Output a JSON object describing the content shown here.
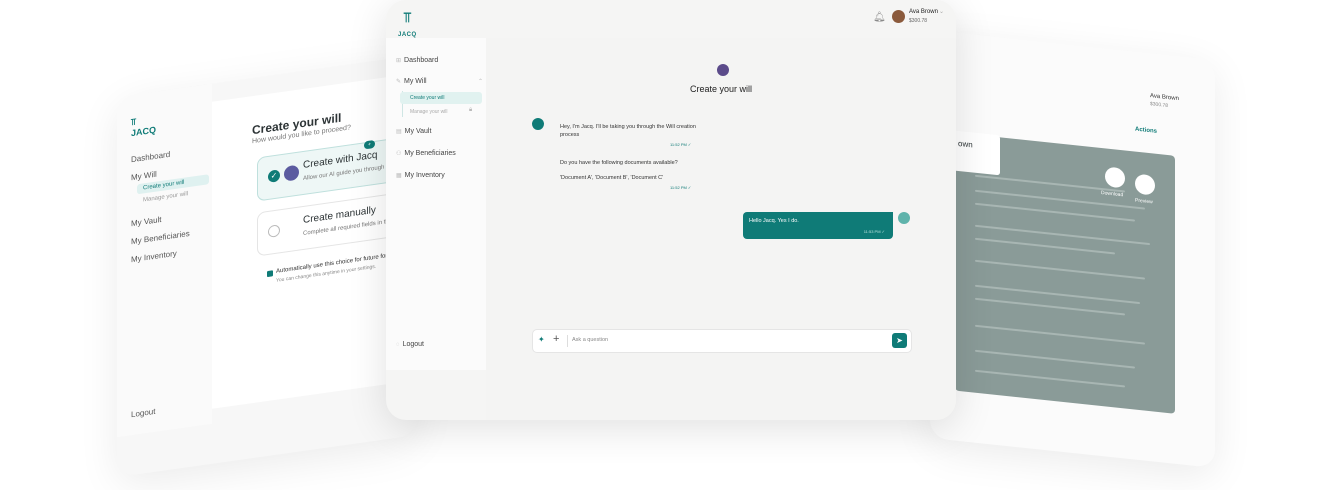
{
  "brand": {
    "name": "JACQ"
  },
  "user": {
    "name": "Ava Brown",
    "balance": "$300.78"
  },
  "nav": {
    "dashboard": "Dashboard",
    "my_will": "My Will",
    "create_will": "Create your will",
    "manage_will": "Manage your will",
    "my_vault": "My Vault",
    "my_beneficiaries": "My Beneficiaries",
    "my_inventory": "My Inventory",
    "logout": "Logout"
  },
  "left_card": {
    "title": "Create your will",
    "subtitle": "How would you like to proceed?",
    "option_jacq_title": "Create with Jacq",
    "option_jacq_desc": "Allow our AI guide you through the will",
    "option_manual_title": "Create manually",
    "option_manual_desc": "Complete all required fields in the w",
    "auto_save": "Automatically use this choice for future forms",
    "auto_save_note": "You can change this anytime in your settings."
  },
  "chat": {
    "title": "Create your will",
    "messages": [
      {
        "text": "Hey, I'm Jacq. I'll be taking you through the Will creation process",
        "time": "11:52 PM ✓"
      },
      {
        "text": "Do you have the following documents available?",
        "time": ""
      },
      {
        "text": "'Document A', 'Document B', 'Document C'",
        "time": "11:52 PM ✓"
      }
    ],
    "user_reply": {
      "text": "Hello Jacq. Yes I do.",
      "time": "11:53 PM ✓"
    },
    "input_placeholder": "Ask a question"
  },
  "right_card": {
    "actions": "Actions",
    "doc_header": "own",
    "download": "Download",
    "preview": "Preview"
  },
  "colors": {
    "accent": "#0f7b77",
    "accent_light": "#e1f2f0"
  }
}
